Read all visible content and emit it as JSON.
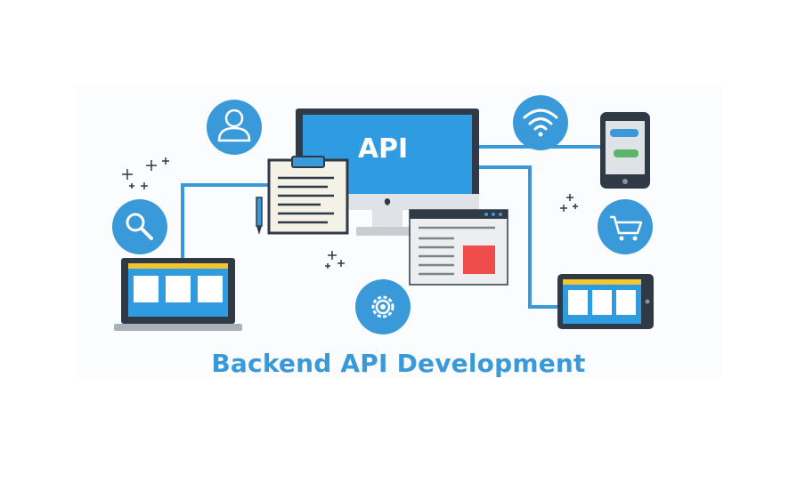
{
  "illustration": {
    "monitor_screen_text": "API",
    "caption": "Backend API Development",
    "icons": [
      "user-icon",
      "search-icon",
      "wifi-icon",
      "cart-icon",
      "gear-icon",
      "sparkle-icon"
    ],
    "colors": {
      "accent_blue": "#3a9ad9",
      "screen_blue": "#2f9be0",
      "device_dark": "#2f3a46",
      "panel_yellow": "#f2c531",
      "red_block": "#ef4c4c",
      "paper": "#f4f1e6",
      "light_gray": "#dfe3e7"
    }
  }
}
